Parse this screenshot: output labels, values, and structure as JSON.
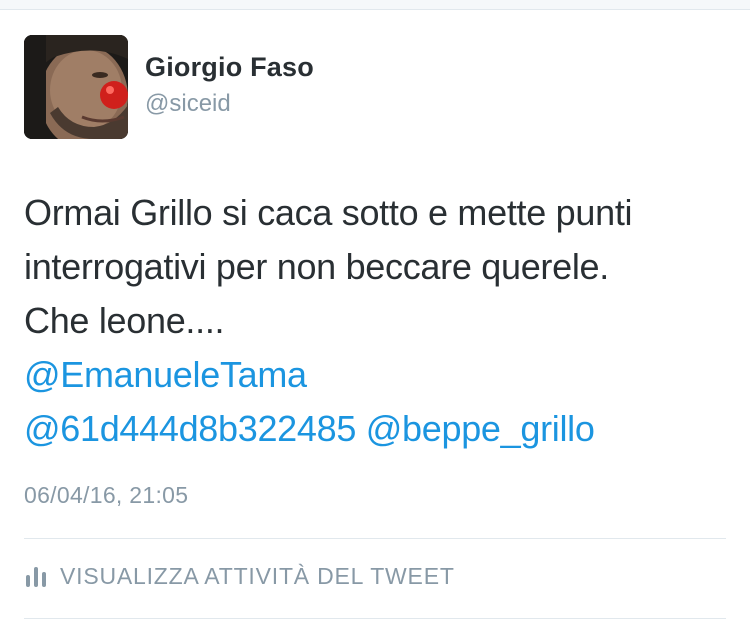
{
  "user": {
    "display_name": "Giorgio Faso",
    "handle": "@siceid",
    "avatar_icon": "profile-photo-clown-nose"
  },
  "tweet": {
    "text_lines": [
      "Ormai Grillo si caca sotto e mette punti",
      "interrogativi per non beccare querele.",
      "Che leone...."
    ],
    "mentions": [
      "@EmanueleTama",
      "@61d444d8b322485",
      "@beppe_grillo"
    ],
    "timestamp": "06/04/16, 21:05"
  },
  "activity": {
    "label": "VISUALIZZA ATTIVITÀ DEL TWEET",
    "icon": "bar-chart-icon"
  },
  "colors": {
    "text": "#292f33",
    "secondary": "#8899a6",
    "link": "#1b95e0",
    "divider": "#e1e8ed"
  }
}
